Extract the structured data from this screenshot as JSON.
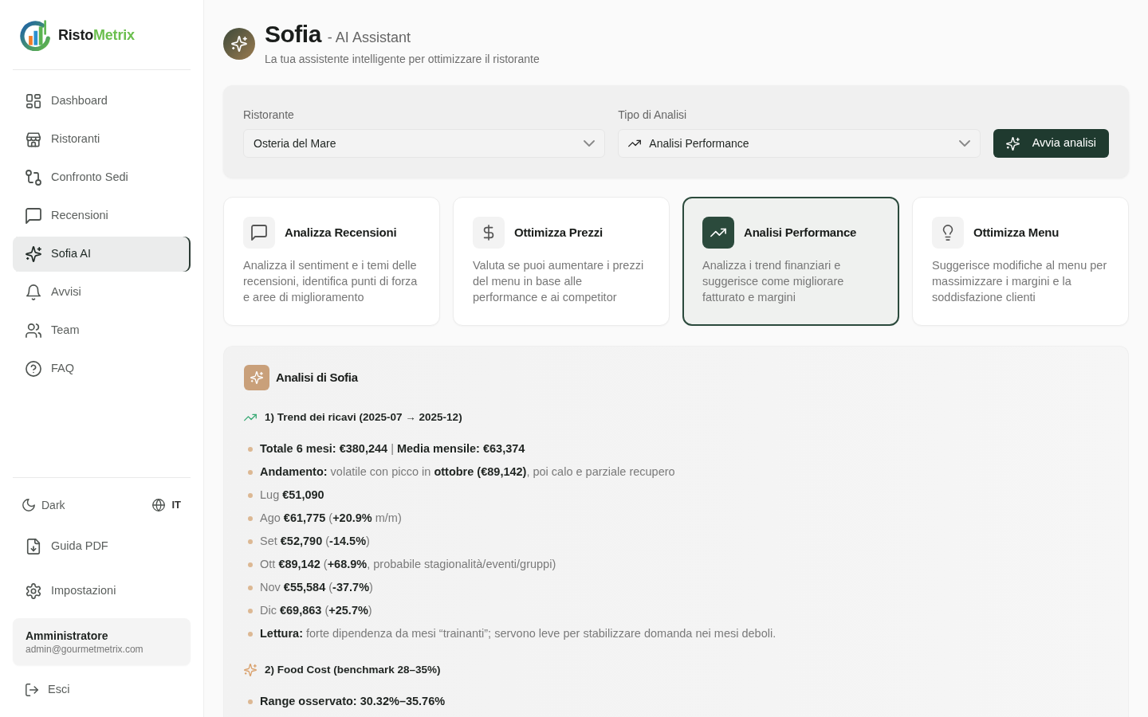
{
  "brand": {
    "name": "Risto",
    "accent": "Metrix"
  },
  "nav": {
    "items": [
      {
        "label": "Dashboard",
        "selected": false
      },
      {
        "label": "Ristoranti",
        "selected": false
      },
      {
        "label": "Confronto Sedi",
        "selected": false
      },
      {
        "label": "Recensioni",
        "selected": false
      },
      {
        "label": "Sofia AI",
        "selected": true
      },
      {
        "label": "Avvisi",
        "selected": false
      },
      {
        "label": "Team",
        "selected": false
      },
      {
        "label": "FAQ",
        "selected": false
      }
    ]
  },
  "sidebar_footer": {
    "theme_toggle": "Dark",
    "language": {
      "label": "IT",
      "selected": true
    },
    "links": [
      "Guida PDF",
      "Impostazioni"
    ],
    "user": {
      "name": "Amministratore",
      "email": "admin@gourmetmetrix.com"
    },
    "logout": "Esci"
  },
  "header": {
    "title": "Sofia",
    "title_suffix": "- AI Assistant",
    "subtitle": "La tua assistente intelligente per ottimizzare il ristorante"
  },
  "filters": {
    "restaurant": {
      "label": "Ristorante",
      "value": "Osteria del Mare"
    },
    "analysis_type": {
      "label": "Tipo di Analisi",
      "value": "Analisi Performance"
    },
    "run_button": "Avvia analisi"
  },
  "analysis_cards": [
    {
      "title": "Analizza Recensioni",
      "description": "Analizza il sentiment e i temi delle recensioni, identifica punti di forza e aree di miglioramento",
      "selected": false
    },
    {
      "title": "Ottimizza Prezzi",
      "description": "Valuta se puoi aumentare i prezzi del menu in base alle performance e ai competitor",
      "selected": false
    },
    {
      "title": "Analisi Performance",
      "description": "Analizza i trend finanziari e suggerisce come migliorare fatturato e margini",
      "selected": true
    },
    {
      "title": "Ottimizza Menu",
      "description": "Suggerisce modifiche al menu per massimizzare i margini e la soddisfazione clienti",
      "selected": false
    }
  ],
  "result": {
    "title": "Analisi di Sofia",
    "sections": [
      {
        "heading": "1) Trend dei ricavi (2025-07 → 2025-12)",
        "bullets": [
          {
            "kind": "mixed",
            "text": "**Totale 6 mesi: €380,244** | **Media mensile: €63,374**"
          },
          {
            "kind": "mixed",
            "text": "**Andamento:** volatile con picco in **ottobre (€89,142)**, poi calo e parziale recupero"
          },
          {
            "kind": "mixed",
            "text": "Lug **€51,090**"
          },
          {
            "kind": "mixed",
            "text": "Ago **€61,775** (**+20.9%** m/m)"
          },
          {
            "kind": "mixed",
            "text": "Set **€52,790** (**-14.5%**)"
          },
          {
            "kind": "mixed",
            "text": "Ott **€89,142** (**+68.9%**, probabile stagionalità/eventi/gruppi)"
          },
          {
            "kind": "mixed",
            "text": "Nov **€55,584** (**-37.7%**)"
          },
          {
            "kind": "mixed",
            "text": "Dic **€69,863** (**+25.7%**)"
          },
          {
            "kind": "mixed",
            "text": "**Lettura:** forte dipendenza da mesi “trainanti”; servono leve per stabilizzare domanda nei mesi deboli."
          }
        ]
      },
      {
        "heading": "2) Food Cost (benchmark 28–35%)",
        "bullets": [
          {
            "kind": "bold",
            "text": "Range osservato: 30.32%–35.76%"
          }
        ]
      }
    ]
  }
}
